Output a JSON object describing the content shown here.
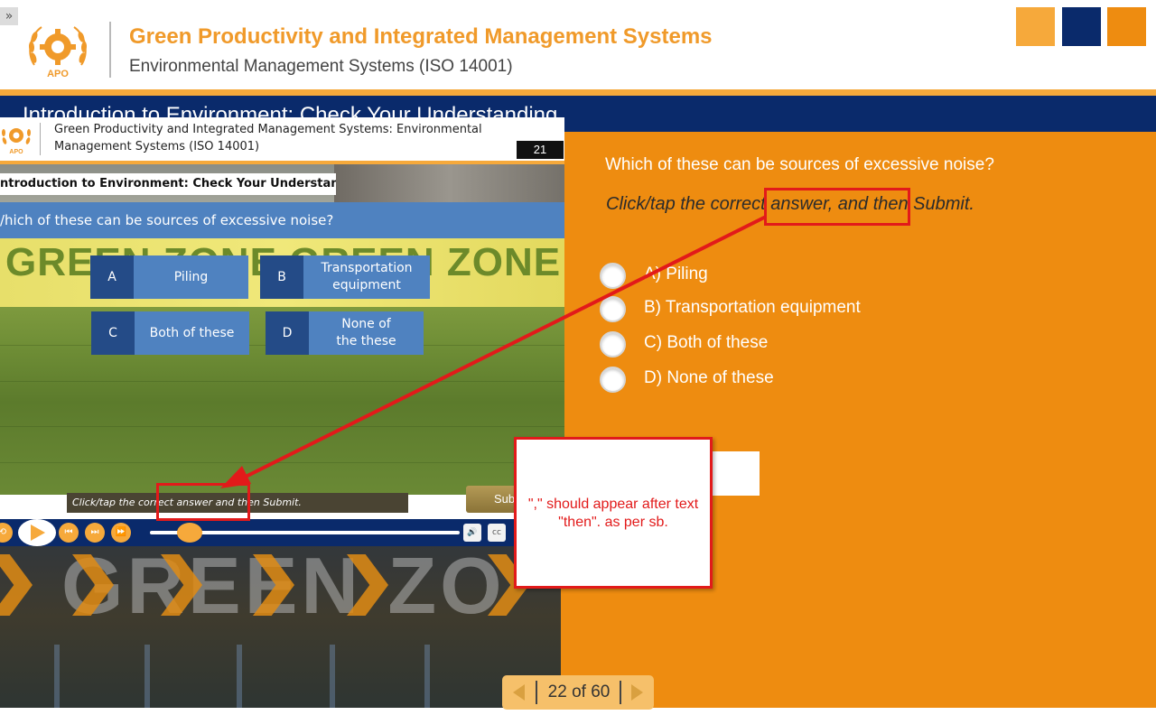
{
  "header": {
    "menu_glyph": "»",
    "logo_text": "APO",
    "course_title": "Green Productivity and Integrated Management Systems",
    "course_subtitle": "Environmental Management Systems (ISO 14001)",
    "colors": {
      "orange": "#ee8c10",
      "light_orange": "#f6a93b",
      "navy": "#0a2a6b"
    }
  },
  "slide": {
    "title": "Introduction to Environment: Check Your Understanding",
    "question": "Which of these can be sources of excessive noise?",
    "instruction": "Click/tap the correct answer, and then Submit.",
    "options": [
      {
        "label": "A)  Piling"
      },
      {
        "label": "B) Transportation equipment"
      },
      {
        "label": "C) Both of these"
      },
      {
        "label": "D)  None of these"
      }
    ],
    "backdrop_text": "GREEN ZO"
  },
  "embedded": {
    "header_title": "Green Productivity and Integrated Management Systems: Environmental Management Systems (ISO 14001)",
    "slide_number": "21",
    "title": "ntroduction to Environment: Check Your Understanding",
    "question": "/hich of these can be sources of excessive noise?",
    "banner_text": "GREEN ZONE GREEN ZONE",
    "options": [
      {
        "letter": "A",
        "text": "Piling"
      },
      {
        "letter": "B",
        "text": "Transportation equipment"
      },
      {
        "letter": "C",
        "text": "Both of these"
      },
      {
        "letter": "D",
        "text": "None of the these"
      }
    ],
    "instruction": "Click/tap the correct answer and then Submit.",
    "submit_label": "Sub",
    "player": {
      "progress": 0.12,
      "volume_icon": "🔊",
      "cc_label": "cc"
    }
  },
  "review_note": "\",\" should appear after text \"then\". as per sb.",
  "nav": {
    "page_label": "22 of 60"
  }
}
